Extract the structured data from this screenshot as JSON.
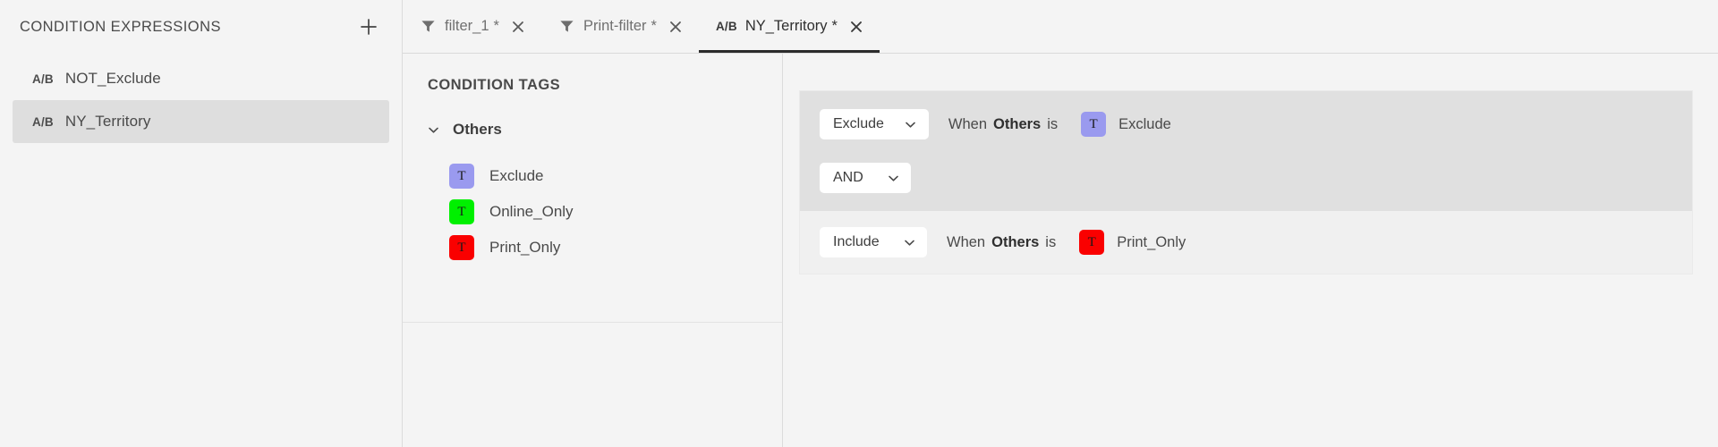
{
  "left_panel": {
    "title": "CONDITION EXPRESSIONS",
    "add_button_label": "+",
    "add_icon": "plus-icon",
    "items": [
      {
        "badge": "A/B",
        "label": "NOT_Exclude",
        "selected": false
      },
      {
        "badge": "A/B",
        "label": "NY_Territory",
        "selected": true
      }
    ]
  },
  "tabs": [
    {
      "icon": "filter-icon",
      "badge": "",
      "label": "filter_1",
      "dirty": "*",
      "close": "✕",
      "active": false
    },
    {
      "icon": "filter-icon",
      "badge": "",
      "label": "Print-filter",
      "dirty": "*",
      "close": "✕",
      "active": false
    },
    {
      "icon": "ab-badge",
      "badge": "A/B",
      "label": "NY_Territory",
      "dirty": "*",
      "close": "✕",
      "active": true
    }
  ],
  "tags_panel": {
    "title": "CONDITION TAGS",
    "group": {
      "label": "Others",
      "expanded": true,
      "chevron_icon": "chevron-down-icon"
    },
    "tags": [
      {
        "glyph": "T",
        "name": "Exclude",
        "color": "#9a9aef"
      },
      {
        "glyph": "T",
        "name": "Online_Only",
        "color": "#00f000"
      },
      {
        "glyph": "T",
        "name": "Print_Only",
        "color": "#fa0000"
      }
    ]
  },
  "rules_panel": {
    "group": {
      "rows": [
        {
          "action": "Exclude",
          "when_label": "When",
          "field": "Others",
          "is_label": "is",
          "tag_glyph": "T",
          "tag_name": "Exclude",
          "tag_color": "#9a9aef"
        }
      ],
      "operator": "AND"
    },
    "second": {
      "action": "Include",
      "when_label": "When",
      "field": "Others",
      "is_label": "is",
      "tag_glyph": "T",
      "tag_name": "Print_Only",
      "tag_color": "#fa0000"
    },
    "caret_icon": "chevron-down-icon"
  },
  "colors": {
    "panel_bg": "#f4f4f4",
    "selected_row": "#dedede",
    "group_block": "#e0e0e0",
    "outer_block": "#f0f0f0",
    "active_tab_underline": "#2b2b2b"
  }
}
